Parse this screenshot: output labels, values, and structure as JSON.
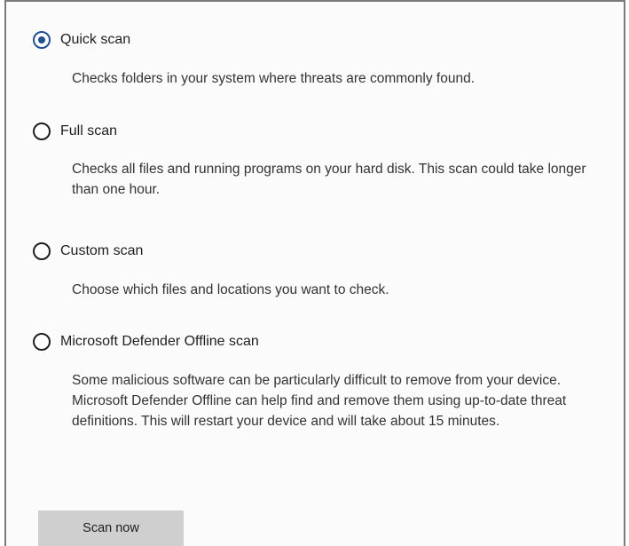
{
  "scan_options": [
    {
      "label": "Quick scan",
      "selected": true,
      "description": "Checks folders in your system where threats are commonly found."
    },
    {
      "label": "Full scan",
      "selected": false,
      "description": "Checks all files and running programs on your hard disk. This scan could take longer than one hour."
    },
    {
      "label": "Custom scan",
      "selected": false,
      "description": "Choose which files and locations you want to check."
    },
    {
      "label": "Microsoft Defender Offline scan",
      "selected": false,
      "description": "Some malicious software can be particularly difficult to remove from your device. Microsoft Defender Offline can help find and remove them using up-to-date threat definitions. This will restart your device and will take about 15 minutes."
    }
  ],
  "actions": {
    "scan_now_label": "Scan now"
  },
  "colors": {
    "accent": "#1f4f9a",
    "button_bg": "#cfcfcf",
    "border": "#7a7a7a"
  }
}
